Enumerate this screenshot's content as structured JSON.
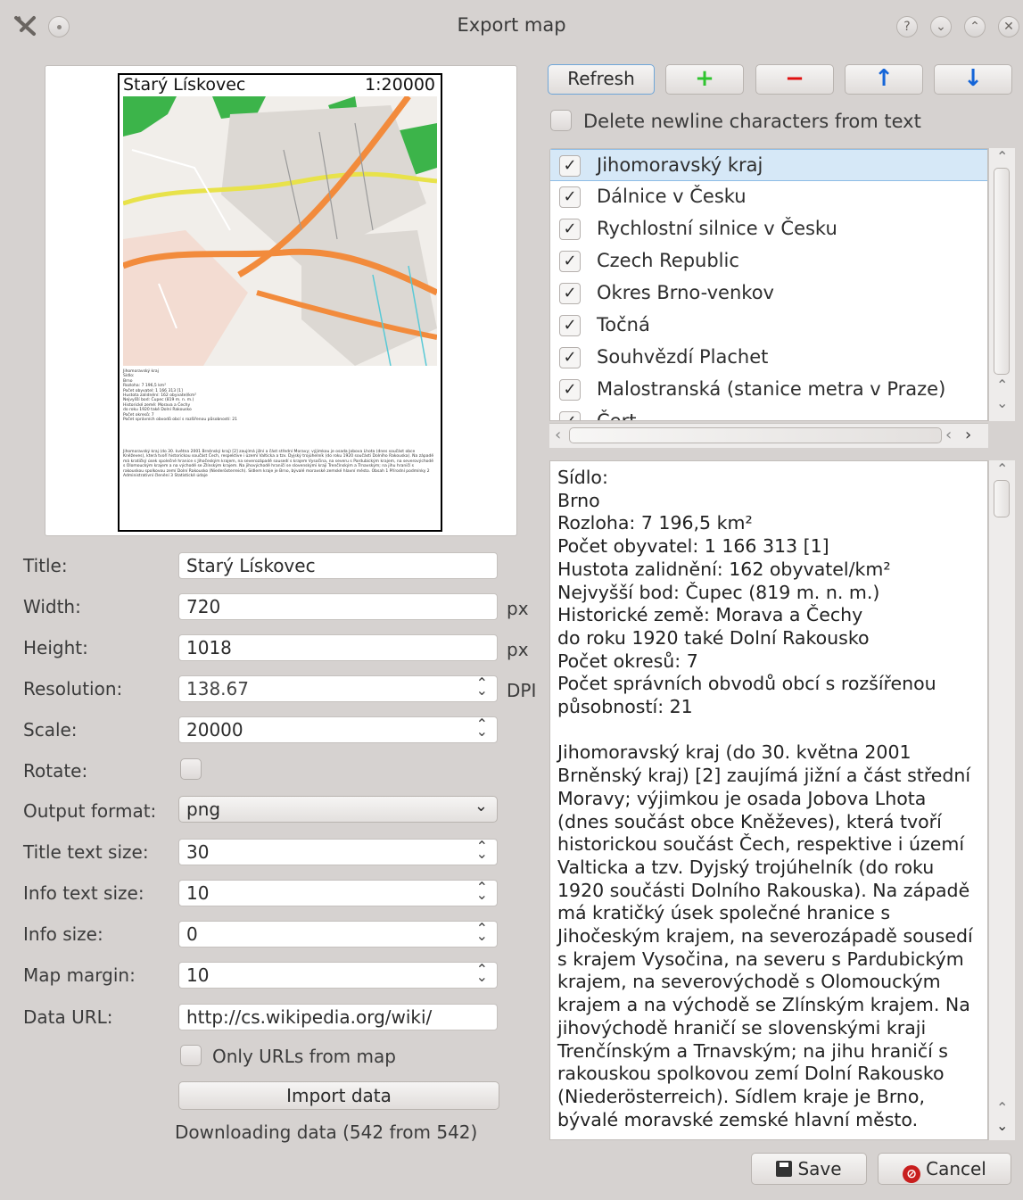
{
  "window": {
    "title": "Export map",
    "controls": [
      "?",
      "⌄",
      "⌃",
      "✕"
    ]
  },
  "preview": {
    "map_title": "Starý Lískovec",
    "scale_label": "1:20000",
    "info_header": "Jihomoravský kraj\nSídlo:\nBrno\nRozloha: 7 196,5 km²\nPočet obyvatel: 1 166 313 [1]\nHustota zalidnění: 162 obyvatel/km²\nNejvyšší bod: Čupec (819 m. n. m.)\nHistorické země: Morava a Čechy\ndo roku 1920 také Dolní Rakousko\nPočet okresů: 7\nPočet správních obvodů obcí s rozšířenou působností: 21",
    "info_body": "Jihomoravský kraj (do 30. května 2001 Brněnský kraj) [2] zaujímá jižní a část střední Moravy; výjimkou je osada Jobova Lhota (dnes součást obce Kněževes), která tvoří historickou součást Čech, respektive i území Valticka a tzv. Dyjský trojúhelník (do roku 1920 součásti Dolního Rakouska). Na západě má kratičký úsek společné hranice s Jihočeským krajem, na severozápadě sousedí s krajem Vysočina, na severu s Pardubickým krajem, na severovýchodě s Olomouckým krajem a na východě se Zlínským krajem. Na jihovýchodě hraničí se slovenskými kraji Trenčínským a Trnavským; na jihu hraničí s rakouskou spolkovou zemí Dolní Rakousko (Niederösterreich). Sídlem kraje je Brno, bývalé moravské zemské hlavní město.\nObsah\n1 Přírodní podmínky\n2 Administrativní členění\n3 Statistické údaje"
  },
  "form": {
    "title_label": "Title:",
    "title_value": "Starý Lískovec",
    "width_label": "Width:",
    "width_value": "720",
    "width_unit": "px",
    "height_label": "Height:",
    "height_value": "1018",
    "height_unit": "px",
    "resolution_label": "Resolution:",
    "resolution_value": "138.67",
    "resolution_unit": "DPI",
    "scale_label": "Scale:",
    "scale_value": "20000",
    "rotate_label": "Rotate:",
    "output_format_label": "Output format:",
    "output_format_value": "png",
    "title_text_size_label": "Title text size:",
    "title_text_size_value": "30",
    "info_text_size_label": "Info text size:",
    "info_text_size_value": "10",
    "info_size_label": "Info size:",
    "info_size_value": "0",
    "map_margin_label": "Map margin:",
    "map_margin_value": "10",
    "data_url_label": "Data URL:",
    "data_url_value": "http://cs.wikipedia.org/wiki/",
    "only_urls_label": "Only URLs from map",
    "import_button": "Import data",
    "status": "Downloading data (542 from 542)"
  },
  "toolbar": {
    "refresh": "Refresh",
    "add": "+",
    "remove": "−",
    "up": "↑",
    "down": "↓"
  },
  "delete_newlines_label": "Delete newline characters from text",
  "layers": [
    {
      "label": "Jihomoravský kraj",
      "checked": true,
      "selected": true
    },
    {
      "label": "Dálnice v Česku",
      "checked": true
    },
    {
      "label": "Rychlostní silnice v Česku",
      "checked": true
    },
    {
      "label": "Czech Republic",
      "checked": true
    },
    {
      "label": "Okres Brno-venkov",
      "checked": true
    },
    {
      "label": "Točná",
      "checked": true
    },
    {
      "label": "Souhvězdí Plachet",
      "checked": true
    },
    {
      "label": "Malostranská (stanice metra v Praze)",
      "checked": true
    },
    {
      "label": "Čert",
      "checked": true
    }
  ],
  "info_text": "Sídlo:\nBrno\nRozloha: 7 196,5 km²\nPočet obyvatel: 1 166 313 [1]\nHustota zalidnění: 162 obyvatel/km²\nNejvyšší bod: Čupec (819 m. n. m.)\nHistorické země: Morava a Čechy\ndo roku 1920 také Dolní Rakousko\nPočet okresů: 7\nPočet správních obvodů obcí s rozšířenou působností: 21\n\nJihomoravský kraj (do 30. května 2001 Brněnský kraj) [2] zaujímá jižní a část střední Moravy; výjimkou je osada Jobova Lhota (dnes součást obce Kněževes), která tvoří historickou součást Čech, respektive i území Valticka a tzv. Dyjský trojúhelník (do roku 1920 součásti Dolního Rakouska). Na západě má kratičký úsek společné hranice s Jihočeským krajem, na severozápadě sousedí s krajem Vysočina, na severu s Pardubickým krajem, na severovýchodě s Olomouckým krajem a na východě se Zlínským krajem. Na jihovýchodě hraničí se slovenskými kraji Trenčínským a Trnavským; na jihu hraničí s rakouskou spolkovou zemí Dolní Rakousko (Niederösterreich). Sídlem kraje je Brno, bývalé moravské zemské hlavní město.",
  "buttons": {
    "save": "Save",
    "cancel": "Cancel"
  },
  "colors": {
    "accent_green": "#2fc42f",
    "accent_red": "#e01010",
    "accent_blue": "#1565d8",
    "selection": "#d6e8f7"
  }
}
